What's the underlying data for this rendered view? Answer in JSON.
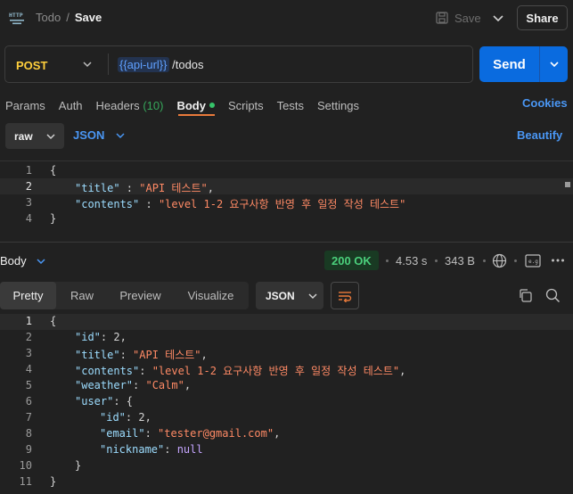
{
  "header": {
    "collection": "Todo",
    "separator": "/",
    "request_name": "Save",
    "save_label": "Save",
    "share_label": "Share"
  },
  "request": {
    "method": "POST",
    "url_variable": "{{api-url}}",
    "url_path": " /todos",
    "send_label": "Send"
  },
  "tabs": [
    {
      "label": "Params"
    },
    {
      "label": "Auth"
    },
    {
      "label": "Headers",
      "count": "(10)"
    },
    {
      "label": "Body",
      "active": true
    },
    {
      "label": "Scripts"
    },
    {
      "label": "Tests"
    },
    {
      "label": "Settings"
    }
  ],
  "cookies_label": "Cookies",
  "body_options": {
    "mode": "raw",
    "language": "JSON",
    "beautify_label": "Beautify"
  },
  "request_body": {
    "line_numbers": [
      "1",
      "2",
      "3",
      "4"
    ],
    "title_key": "\"title\"",
    "title_value": "\"API 테스트\"",
    "contents_key": "\"contents\"",
    "contents_value": "\"level 1-2 요구사항 반영 후 일정 작성 테스트\""
  },
  "response": {
    "section_label": "Body",
    "status": "200 OK",
    "time": "4.53 s",
    "size": "343 B",
    "view_tabs": [
      "Pretty",
      "Raw",
      "Preview",
      "Visualize"
    ],
    "active_view": "Pretty",
    "format": "JSON",
    "line_numbers": [
      "1",
      "2",
      "3",
      "4",
      "5",
      "6",
      "7",
      "8",
      "9",
      "10",
      "11"
    ],
    "id_key": "\"id\"",
    "id_value": "2",
    "title_key": "\"title\"",
    "title_value": "\"API 테스트\"",
    "contents_key": "\"contents\"",
    "contents_value": "\"level 1-2 요구사항 반영 후 일정 작성 테스트\"",
    "weather_key": "\"weather\"",
    "weather_value": "\"Calm\"",
    "user_key": "\"user\"",
    "user_id_key": "\"id\"",
    "user_id_value": "2",
    "email_key": "\"email\"",
    "email_value": "\"tester@gmail.com\"",
    "nickname_key": "\"nickname\"",
    "nickname_value": "null"
  },
  "colors": {
    "accent_blue": "#0a6bdf",
    "method_post": "#ffcf3c",
    "status_ok": "#4bd07c",
    "active_tab_underline": "#e97a3b"
  },
  "icons": [
    "http-icon",
    "save-icon",
    "chevron-down-icon",
    "globe-icon",
    "example-icon",
    "more-icon",
    "wrap-icon",
    "copy-icon",
    "search-icon"
  ]
}
